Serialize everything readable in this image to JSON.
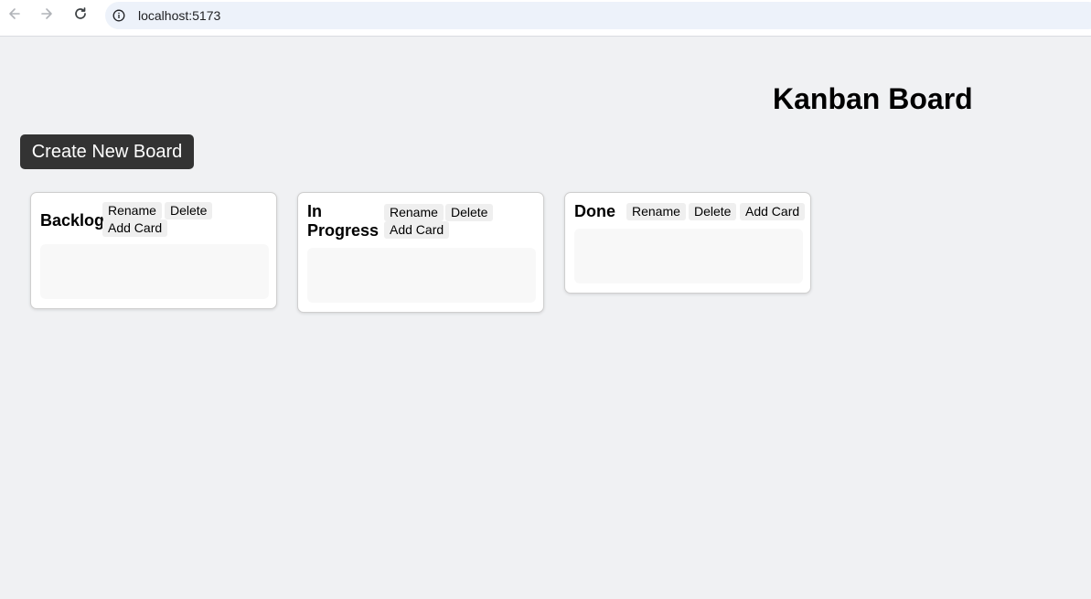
{
  "browser": {
    "url": "localhost:5173",
    "icons": {
      "back": "arrow-left-icon",
      "forward": "arrow-right-icon",
      "reload": "reload-icon",
      "site_info": "info-icon"
    }
  },
  "page": {
    "title": "Kanban Board",
    "create_board_label": "Create New Board"
  },
  "colors": {
    "background": "#f0f1f3",
    "primary_button": "#333333",
    "column_bg": "#ffffff",
    "control_button_bg": "#efefef",
    "card_area_bg": "#f8f8f8"
  },
  "columns": [
    {
      "title": "Backlog",
      "rename_label": "Rename",
      "delete_label": "Delete",
      "add_card_label": "Add Card"
    },
    {
      "title": "In Progress",
      "rename_label": "Rename",
      "delete_label": "Delete",
      "add_card_label": "Add Card"
    },
    {
      "title": "Done",
      "rename_label": "Rename",
      "delete_label": "Delete",
      "add_card_label": "Add Card"
    }
  ]
}
